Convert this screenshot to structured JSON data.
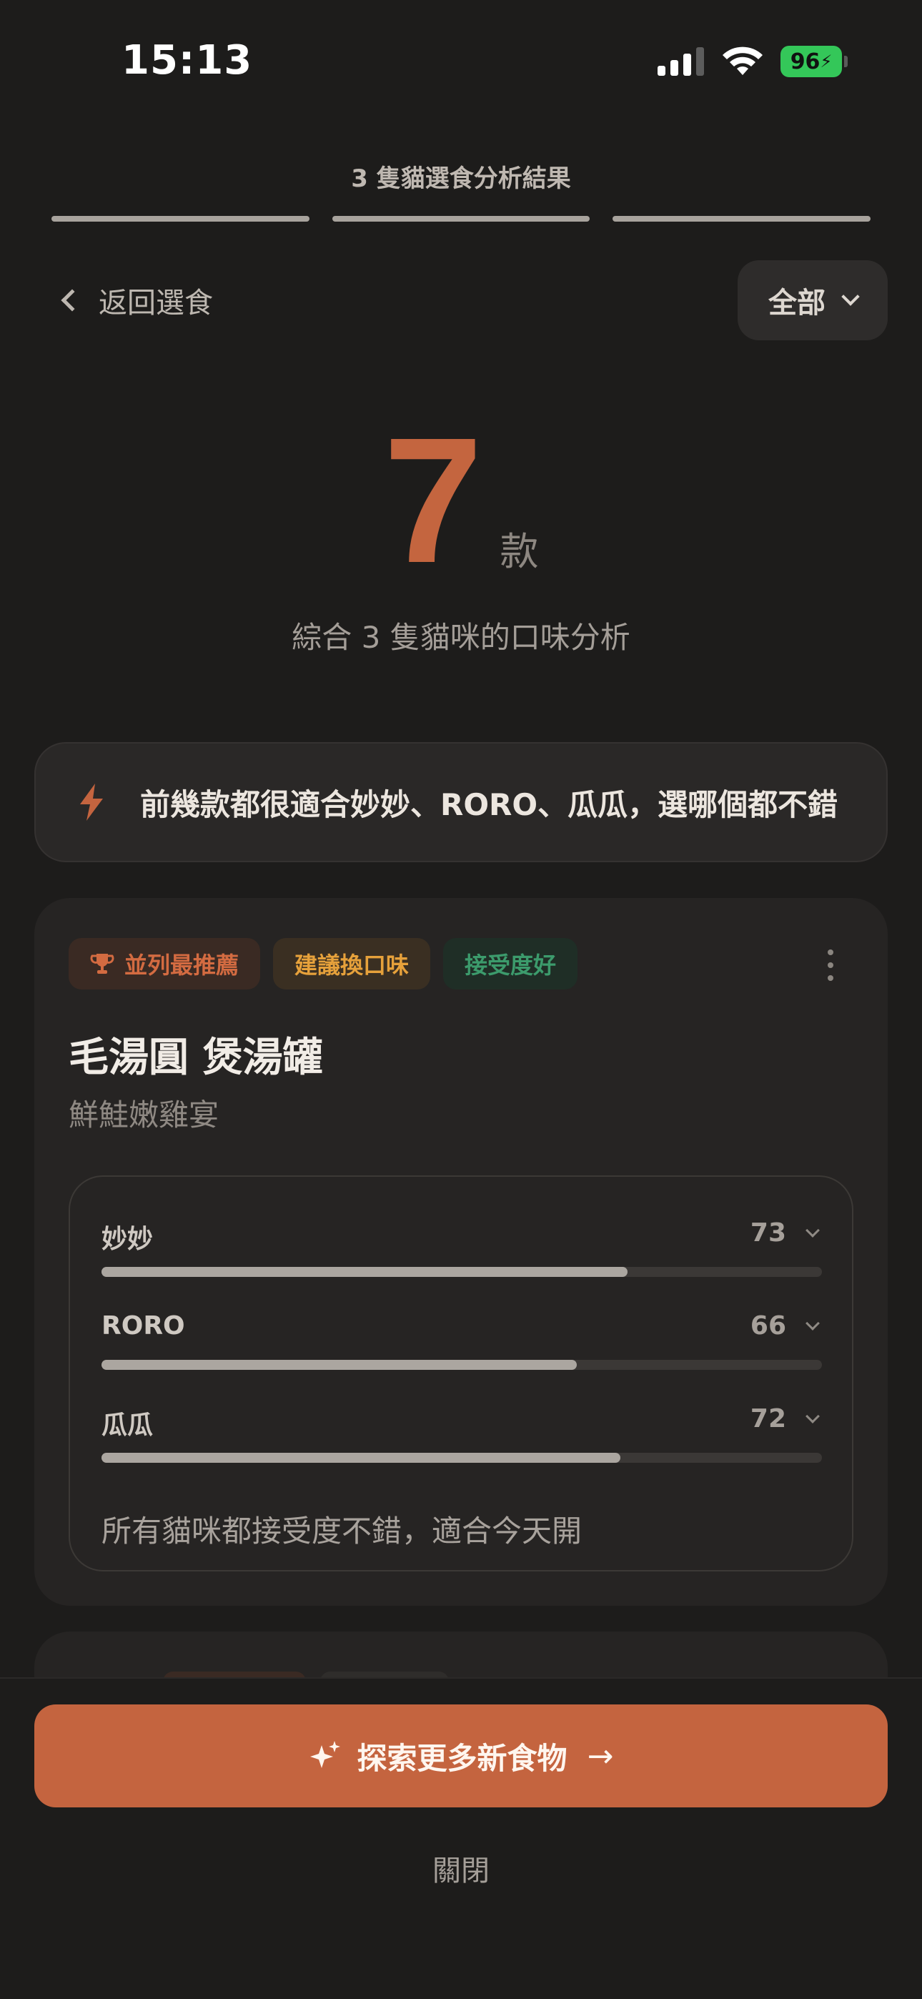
{
  "status_bar": {
    "time": "15:13",
    "battery": "96",
    "icons": [
      "cellular-signal-icon",
      "wifi-icon",
      "battery-charging-icon"
    ]
  },
  "header": {
    "title": "3 隻貓選食分析結果",
    "back_label": "返回選食",
    "filter_label": "全部"
  },
  "summary": {
    "count": "7",
    "unit": "款",
    "subtitle": "綜合 3 隻貓咪的口味分析"
  },
  "tip": {
    "icon": "lightning-icon",
    "text": "前幾款都很適合妙妙、RORO、瓜瓜，選哪個都不錯"
  },
  "food_card": {
    "tags": [
      {
        "label": "並列最推薦",
        "icon": "trophy-icon",
        "color": "#d36b41"
      },
      {
        "label": "建議換口味",
        "color": "#e6a13b"
      },
      {
        "label": "接受度好",
        "color": "#3c9b6c"
      }
    ],
    "name": "毛湯圓 煲湯罐",
    "flavor": "鮮鮭嫩雞宴",
    "scores": [
      {
        "cat": "妙妙",
        "score": 73
      },
      {
        "cat": "RORO",
        "score": 66
      },
      {
        "cat": "瓜瓜",
        "score": 72
      }
    ],
    "note": "所有貓咪都接受度不錯，適合今天開"
  },
  "actions": {
    "explore_label": "探索更多新食物",
    "close_label": "關閉"
  },
  "colors": {
    "accent": "#c4643f",
    "background": "#1d1c1b",
    "card": "#262423"
  }
}
